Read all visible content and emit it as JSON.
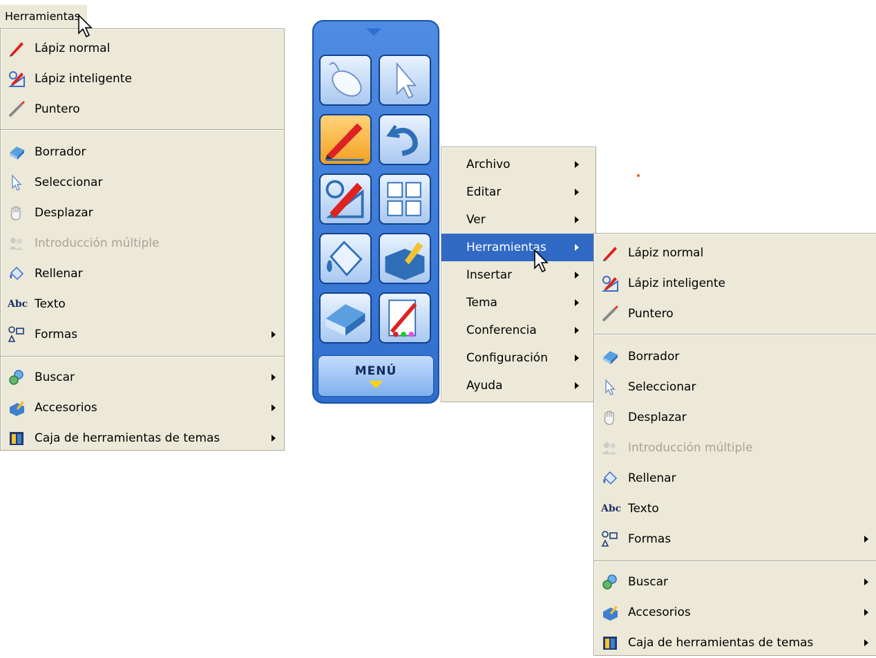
{
  "menubar": {
    "label": "Herramientas"
  },
  "tools_menu": {
    "items": [
      {
        "label": "Lápiz normal",
        "icon": "pen-icon",
        "submenu": false,
        "disabled": false
      },
      {
        "label": "Lápiz inteligente",
        "icon": "smart-pen-icon",
        "submenu": false,
        "disabled": false
      },
      {
        "label": "Puntero",
        "icon": "pointer-icon",
        "submenu": false,
        "disabled": false
      },
      {
        "label": "Borrador",
        "icon": "eraser-icon",
        "submenu": false,
        "disabled": false
      },
      {
        "label": "Seleccionar",
        "icon": "select-arrow-icon",
        "submenu": false,
        "disabled": false
      },
      {
        "label": "Desplazar",
        "icon": "hand-icon",
        "submenu": false,
        "disabled": false
      },
      {
        "label": "Introducción múltiple",
        "icon": "multi-user-icon",
        "submenu": false,
        "disabled": true
      },
      {
        "label": "Rellenar",
        "icon": "fill-icon",
        "submenu": false,
        "disabled": false
      },
      {
        "label": "Texto",
        "icon": "text-icon",
        "icon_text": "Abc",
        "submenu": false,
        "disabled": false
      },
      {
        "label": "Formas",
        "icon": "shapes-icon",
        "submenu": true,
        "disabled": false
      },
      {
        "label": "Buscar",
        "icon": "search-icon",
        "submenu": true,
        "disabled": false
      },
      {
        "label": "Accesorios",
        "icon": "accessories-icon",
        "submenu": true,
        "disabled": false
      },
      {
        "label": "Caja de herramientas de temas",
        "icon": "toolbox-icon",
        "submenu": true,
        "disabled": false
      }
    ]
  },
  "main_menu": {
    "items": [
      {
        "label": "Archivo",
        "highlighted": false
      },
      {
        "label": "Editar",
        "highlighted": false
      },
      {
        "label": "Ver",
        "highlighted": false
      },
      {
        "label": "Herramientas",
        "highlighted": true
      },
      {
        "label": "Insertar",
        "highlighted": false
      },
      {
        "label": "Tema",
        "highlighted": false
      },
      {
        "label": "Conferencia",
        "highlighted": false
      },
      {
        "label": "Configuración",
        "highlighted": false
      },
      {
        "label": "Ayuda",
        "highlighted": false
      }
    ]
  },
  "toolbar": {
    "menu_label": "MENÚ",
    "buttons": [
      {
        "icon": "mouse-icon",
        "active": false
      },
      {
        "icon": "select-arrow-icon",
        "active": false
      },
      {
        "icon": "pen-icon",
        "active": true
      },
      {
        "icon": "undo-icon",
        "active": false
      },
      {
        "icon": "smart-pen-icon",
        "active": false
      },
      {
        "icon": "page-layout-icon",
        "active": false
      },
      {
        "icon": "fill-icon",
        "active": false
      },
      {
        "icon": "toolbox-icon",
        "active": false
      },
      {
        "icon": "eraser-icon",
        "active": false
      },
      {
        "icon": "settings-icon",
        "active": false
      }
    ]
  },
  "colors": {
    "menu_bg": "#ece9d8",
    "highlight": "#316ac5",
    "disabled_text": "#a7a397",
    "toolbar_blue": "#2f6ecd",
    "active_button": "#f3a021"
  }
}
